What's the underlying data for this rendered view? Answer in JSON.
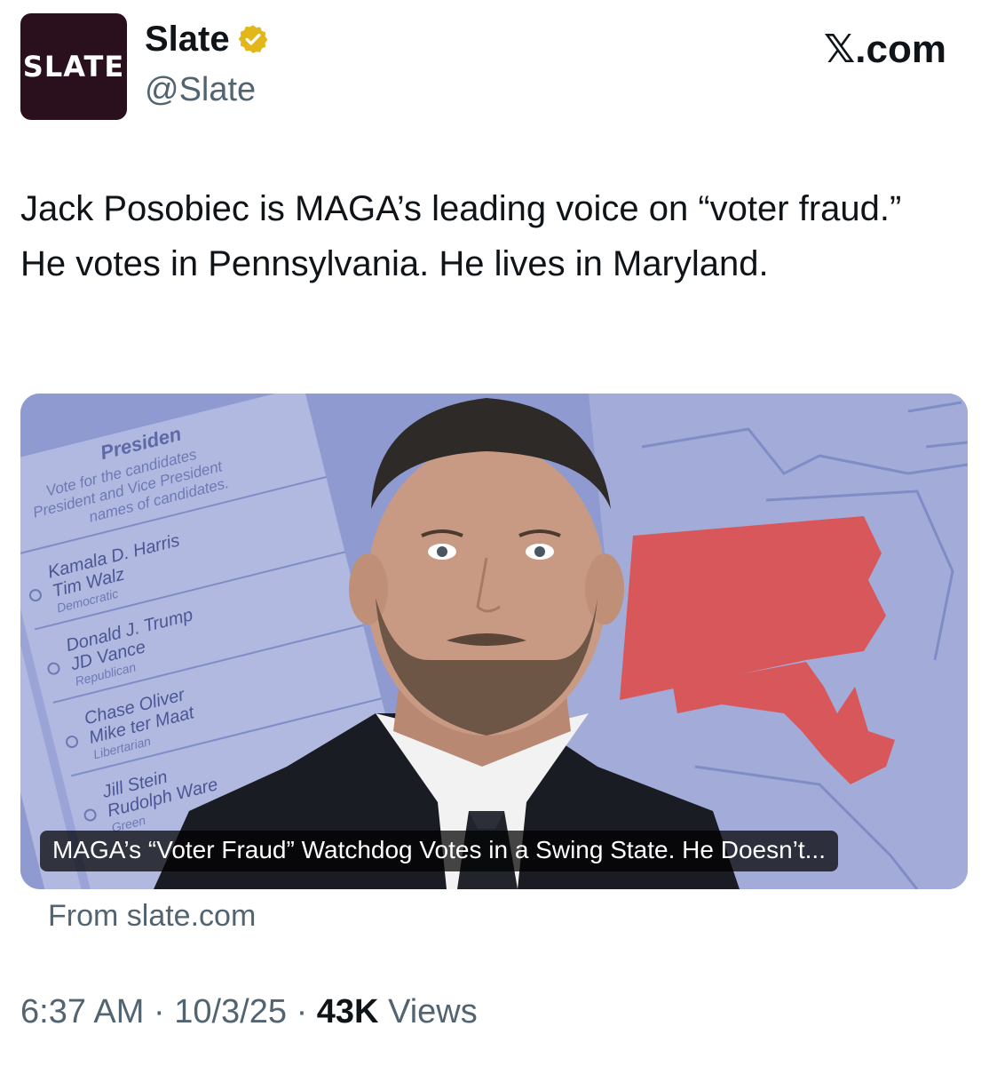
{
  "account": {
    "avatar_text": "SLATE",
    "display_name": "Slate",
    "handle": "@Slate",
    "verified": true,
    "verified_icon": "verified-badge-gold"
  },
  "platform": {
    "logo_text": "𝕏.com"
  },
  "tweet": {
    "text": "Jack Posobiec is MAGA’s leading voice on “voter fraud.” He votes in Pennsylvania. He lives in Maryland."
  },
  "card": {
    "headline": "MAGA’s “Voter Fraud” Watchdog Votes in a Swing State. He Doesn’t...",
    "source": "From slate.com",
    "ballot": {
      "heading": "Presiden",
      "instructions": [
        "Vote for the candidates",
        "President and Vice President",
        "names of candidates."
      ],
      "candidates": [
        {
          "line1": "Kamala D. Harris",
          "line2": "Tim Walz",
          "party": "Democratic"
        },
        {
          "line1": "Donald J. Trump",
          "line2": "JD Vance",
          "party": "Republican"
        },
        {
          "line1": "Chase Oliver",
          "line2": "Mike ter Maat",
          "party": "Libertarian"
        },
        {
          "line1": "Jill Stein",
          "line2": "Rudolph Ware",
          "party": "Green"
        }
      ]
    },
    "colors": {
      "background": "#8e9ad0",
      "highlight_states": "#d8575a"
    }
  },
  "meta": {
    "time": "6:37 AM",
    "date": "10/3/25",
    "separator": "·",
    "views_count": "43K",
    "views_label": "Views"
  }
}
